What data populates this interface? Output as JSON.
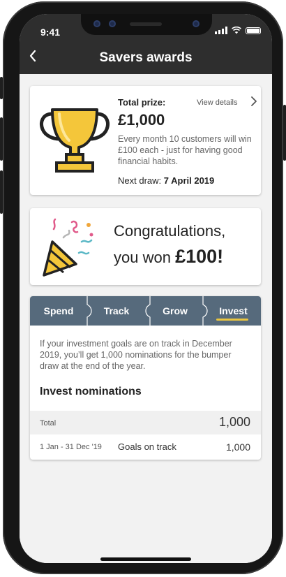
{
  "status": {
    "time": "9:41"
  },
  "header": {
    "title": "Savers awards",
    "back_icon": "chevron-left-icon"
  },
  "prize": {
    "label": "Total prize:",
    "amount": "£1,000",
    "view_details": "View details",
    "description": "Every month 10 customers will win £100 each - just for having good financial habits.",
    "next_draw_label": "Next draw:",
    "next_draw_date": "7 April 2019",
    "colors": {
      "trophy": "#f4c63a",
      "outline": "#222222"
    }
  },
  "congrats": {
    "line1": "Congratulations,",
    "line2_prefix": "you won",
    "amount": "£100!"
  },
  "tabs": {
    "items": [
      {
        "label": "Spend"
      },
      {
        "label": "Track"
      },
      {
        "label": "Grow"
      },
      {
        "label": "Invest"
      }
    ],
    "active_index": 3,
    "colors": {
      "bar": "#566a7c",
      "underline": "#e9c540"
    }
  },
  "invest": {
    "description": "If your investment goals are on track in December 2019, you’ll get 1,000 nominations for the bumper draw at the end of the year.",
    "heading": "Invest nominations",
    "total_label": "Total",
    "total_value": "1,000",
    "rows": [
      {
        "date": "1 Jan - 31 Dec '19",
        "label": "Goals on track",
        "value": "1,000"
      }
    ]
  }
}
